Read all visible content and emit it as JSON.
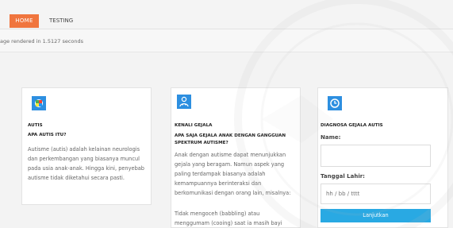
{
  "nav": {
    "home_label": "HOME",
    "testing_label": "TESTING"
  },
  "render_note": "age rendered in 1.5127 seconds",
  "cards": {
    "autis": {
      "title": "AUTIS",
      "subtitle": "APA AUTIS ITU?",
      "lines": [
        "Autisme (autis) adalah kelainan neurologis",
        "dan perkembangan yang biasanya muncul",
        "pada usia anak-anak. Hingga kini, penyebab",
        "autisme tidak diketahui secara pasti."
      ]
    },
    "gejala": {
      "title": "KENALI GEJALA",
      "subtitle_lines": [
        "APA SAJA GEJALA ANAK DENGAN GANGGUAN",
        "SPEKTRUM AUTISME?"
      ],
      "lines": [
        "Anak dengan autisme dapat menunjukkan",
        "gejala yang beragam. Namun aspek yang",
        "paling terdampak biasanya adalah",
        "kemampuannya berinteraksi dan",
        "berkomunikasi dengan orang lain, misalnya:"
      ],
      "lines2": [
        "Tidak mengoceh (babbling) atau",
        "menggumam (cooing) saat ia masih bayi"
      ]
    },
    "diagnosa": {
      "title": "DIAGNOSA GEJALA AUTIS",
      "name_label": "Name:",
      "name_value": "",
      "dob_label": "Tanggal Lahir:",
      "dob_placeholder": "hh / bb / tttt",
      "submit_label": "Lanjutkan"
    }
  },
  "colors": {
    "accent_orange": "#f0753e",
    "icon_blue": "#2d8fe0",
    "button_blue": "#29a9e3"
  },
  "icons": {
    "card1": "puzzle-icon",
    "card2": "user-medical-icon",
    "card3": "clock-icon"
  }
}
